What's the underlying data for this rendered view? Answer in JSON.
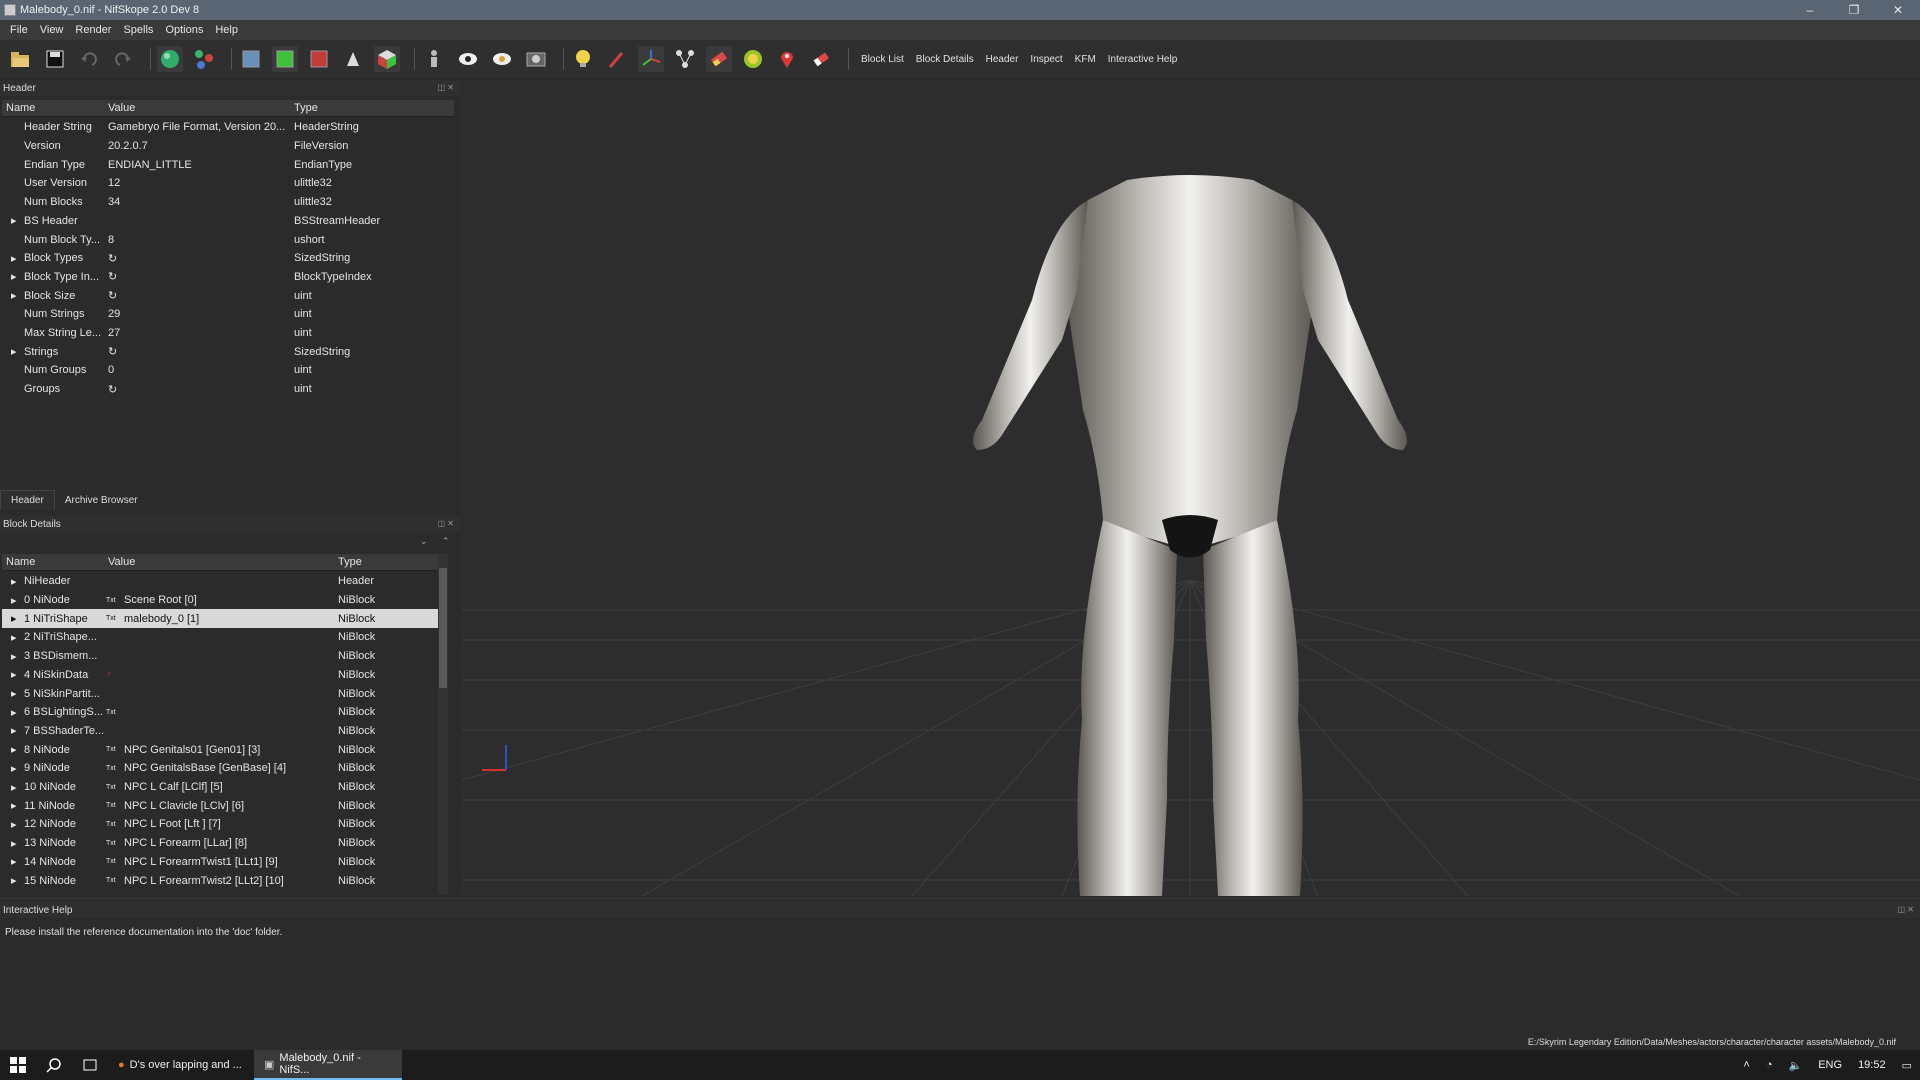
{
  "window": {
    "title": "Malebody_0.nif - NifSkope 2.0 Dev 8",
    "minimize": "–",
    "maximize": "❐",
    "close": "✕"
  },
  "menu": [
    "File",
    "View",
    "Render",
    "Spells",
    "Options",
    "Help"
  ],
  "toolbar": {
    "text_buttons": [
      "Block List",
      "Block Details",
      "Header",
      "Inspect",
      "KFM",
      "Interactive Help"
    ]
  },
  "header_panel": {
    "title": "Header",
    "columns": [
      "Name",
      "Value",
      "Type"
    ],
    "rows": [
      {
        "name": "Header String",
        "value": "Gamebryo File Format, Version 20...",
        "type": "HeaderString",
        "expand": false
      },
      {
        "name": "Version",
        "value": "20.2.0.7",
        "type": "FileVersion",
        "expand": false
      },
      {
        "name": "Endian Type",
        "value": "ENDIAN_LITTLE",
        "type": "EndianType",
        "expand": false
      },
      {
        "name": "User Version",
        "value": "12",
        "type": "ulittle32",
        "expand": false
      },
      {
        "name": "Num Blocks",
        "value": "34",
        "type": "ulittle32",
        "expand": false
      },
      {
        "name": "BS Header",
        "value": "",
        "type": "BSStreamHeader",
        "expand": true
      },
      {
        "name": "Num Block Ty...",
        "value": "8",
        "type": "ushort",
        "expand": false
      },
      {
        "name": "Block Types",
        "value": "",
        "type": "SizedString",
        "expand": true,
        "icon": true
      },
      {
        "name": "Block Type In...",
        "value": "",
        "type": "BlockTypeIndex",
        "expand": true,
        "icon": true
      },
      {
        "name": "Block Size",
        "value": "",
        "type": "uint",
        "expand": true,
        "icon": true
      },
      {
        "name": "Num Strings",
        "value": "29",
        "type": "uint",
        "expand": false
      },
      {
        "name": "Max String Le...",
        "value": "27",
        "type": "uint",
        "expand": false
      },
      {
        "name": "Strings",
        "value": "",
        "type": "SizedString",
        "expand": true,
        "icon": true
      },
      {
        "name": "Num Groups",
        "value": "0",
        "type": "uint",
        "expand": false
      },
      {
        "name": "Groups",
        "value": "",
        "type": "uint",
        "expand": false,
        "icon": true
      }
    ]
  },
  "left_tabs": [
    "Header",
    "Archive Browser"
  ],
  "block_panel": {
    "title": "Block Details",
    "columns": [
      "Name",
      "Value",
      "Type"
    ],
    "rows": [
      {
        "name": "NiHeader",
        "value": "",
        "type": "Header"
      },
      {
        "name": "0 NiNode",
        "value": "Scene Root [0]",
        "type": "NiBlock",
        "txt": true
      },
      {
        "name": "1 NiTriShape",
        "value": "malebody_0 [1]",
        "type": "NiBlock",
        "txt": true,
        "selected": true
      },
      {
        "name": "2 NiTriShape...",
        "value": "",
        "type": "NiBlock"
      },
      {
        "name": "3 BSDismem...",
        "value": "",
        "type": "NiBlock"
      },
      {
        "name": "4 NiSkinData",
        "value": "",
        "type": "NiBlock",
        "mark": true
      },
      {
        "name": "5 NiSkinPartit...",
        "value": "",
        "type": "NiBlock"
      },
      {
        "name": "6 BSLightingS...",
        "value": "",
        "type": "NiBlock",
        "txt": true
      },
      {
        "name": "7 BSShaderTe...",
        "value": "",
        "type": "NiBlock"
      },
      {
        "name": "8 NiNode",
        "value": "NPC Genitals01 [Gen01] [3]",
        "type": "NiBlock",
        "txt": true
      },
      {
        "name": "9 NiNode",
        "value": "NPC GenitalsBase [GenBase] [4]",
        "type": "NiBlock",
        "txt": true
      },
      {
        "name": "10 NiNode",
        "value": "NPC L Calf [LClf] [5]",
        "type": "NiBlock",
        "txt": true
      },
      {
        "name": "11 NiNode",
        "value": "NPC L Clavicle [LClv] [6]",
        "type": "NiBlock",
        "txt": true
      },
      {
        "name": "12 NiNode",
        "value": "NPC L Foot [Lft ] [7]",
        "type": "NiBlock",
        "txt": true
      },
      {
        "name": "13 NiNode",
        "value": "NPC L Forearm [LLar] [8]",
        "type": "NiBlock",
        "txt": true
      },
      {
        "name": "14 NiNode",
        "value": "NPC L ForearmTwist1 [LLt1] [9]",
        "type": "NiBlock",
        "txt": true
      },
      {
        "name": "15 NiNode",
        "value": "NPC L ForearmTwist2 [LLt2] [10]",
        "type": "NiBlock",
        "txt": true
      }
    ]
  },
  "help_panel": {
    "title": "Interactive Help",
    "text": "Please install the reference documentation into the 'doc' folder."
  },
  "status": {
    "path": "E:/Skyrim Legendary Edition/Data/Meshes/actors/character/character assets/Malebody_0.nif"
  },
  "taskbar": {
    "items": [
      "D's over lapping and ...",
      "Malebody_0.nif - NifS..."
    ],
    "language": "ENG",
    "time": "19:52"
  },
  "colors": {
    "titlebar": "#596573",
    "selection": "#d9d9d9",
    "viewport_bg": "#2d2d2d"
  }
}
